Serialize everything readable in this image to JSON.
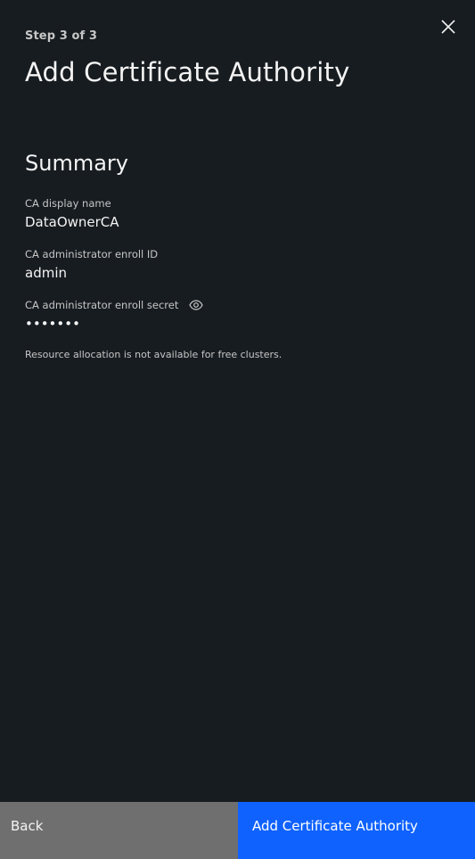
{
  "header": {
    "step": "Step 3 of 3",
    "title": "Add Certificate Authority"
  },
  "summary": {
    "heading": "Summary",
    "display_name": {
      "label": "CA display name",
      "value": "DataOwnerCA"
    },
    "enroll_id": {
      "label": "CA administrator enroll ID",
      "value": "admin"
    },
    "enroll_secret": {
      "label": "CA administrator enroll secret",
      "value": "•••••••"
    },
    "note": "Resource allocation is not available for free clusters."
  },
  "footer": {
    "back_label": "Back",
    "submit_label": "Add Certificate Authority"
  },
  "icons": {
    "close": "close-icon",
    "reveal": "eye-icon"
  },
  "colors": {
    "background": "#171c20",
    "primary": "#0f62fe",
    "secondary": "#6f6f6f"
  }
}
